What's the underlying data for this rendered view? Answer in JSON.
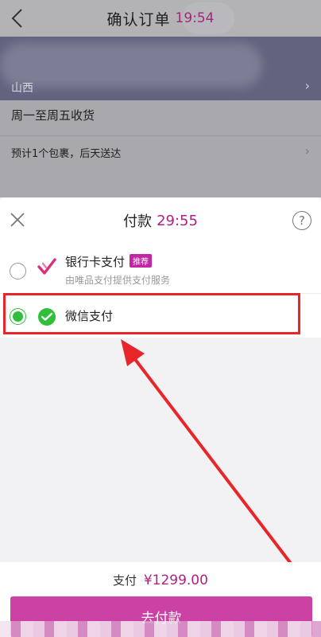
{
  "background_page": {
    "title": "确认订单",
    "clock": "19:54",
    "address_line": "山西",
    "delivery_time": "周一至周五收货",
    "package_info": "预计1个包裹，后天送达"
  },
  "payment_sheet": {
    "title": "付款",
    "countdown": "29:55",
    "help_symbol": "?",
    "methods": [
      {
        "name": "银行卡支付",
        "badge": "推荐",
        "subtitle": "由唯品支付提供支付服务",
        "selected": false,
        "icon": "vip-pay-check-icon"
      },
      {
        "name": "微信支付",
        "selected": true,
        "icon": "wechat-pay-icon"
      }
    ],
    "summary_label": "支付",
    "amount": "¥1299.00",
    "pay_button_label": "去付款"
  },
  "colors": {
    "accent": "#b01f82",
    "button": "#cc42a4",
    "wechat_green": "#2fbf3a",
    "annotation_red": "#e8262a"
  }
}
